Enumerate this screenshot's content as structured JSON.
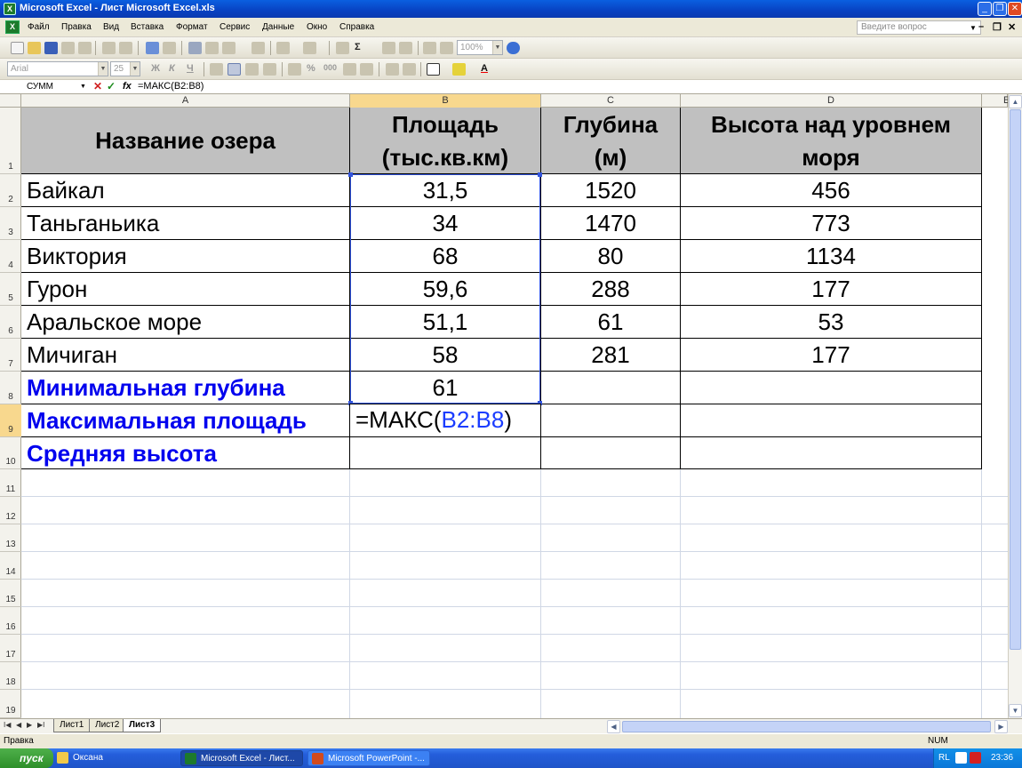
{
  "window": {
    "title": "Microsoft Excel - Лист Microsoft Excel.xls"
  },
  "menu": {
    "items": [
      "Файл",
      "Правка",
      "Вид",
      "Вставка",
      "Формат",
      "Сервис",
      "Данные",
      "Окно",
      "Справка"
    ],
    "help_placeholder": "Введите вопрос"
  },
  "toolbar": {
    "zoom": "100%",
    "font_name": "Arial",
    "font_size": "25",
    "sigma": "Σ",
    "bold": "Ж",
    "italic": "К",
    "underline": "Ч",
    "percent": "%",
    "thousands": "000",
    "font_color": "A"
  },
  "formula_bar": {
    "name_box": "СУММ",
    "fx": "fx",
    "formula": "=МАКС(B2:B8)"
  },
  "columns": [
    "A",
    "B",
    "C",
    "D",
    "E"
  ],
  "rows": [
    "1",
    "2",
    "3",
    "4",
    "5",
    "6",
    "7",
    "8",
    "9",
    "10",
    "11",
    "12",
    "13",
    "14",
    "15",
    "16",
    "17",
    "18",
    "19"
  ],
  "table": {
    "headers": [
      "Название озера",
      "Площадь (тыс.кв.км)",
      "Глубина (м)",
      "Высота над уровнем моря"
    ],
    "rows": [
      {
        "name": "Байкал",
        "area": "31,5",
        "depth": "1520",
        "height": "456"
      },
      {
        "name": "Таньганьика",
        "area": "34",
        "depth": "1470",
        "height": "773"
      },
      {
        "name": "Виктория",
        "area": "68",
        "depth": "80",
        "height": "1134"
      },
      {
        "name": "Гурон",
        "area": "59,6",
        "depth": "288",
        "height": "177"
      },
      {
        "name": "Аральское море",
        "area": "51,1",
        "depth": "61",
        "height": "53"
      },
      {
        "name": "Мичиган",
        "area": "58",
        "depth": "281",
        "height": "177"
      }
    ],
    "summary": [
      {
        "label": "Минимальная глубина",
        "value": "61"
      },
      {
        "label": "Максимальная площадь",
        "value": ""
      },
      {
        "label": "Средняя высота",
        "value": ""
      }
    ],
    "edit_prefix": "=МАКС(",
    "edit_ref": "B2:B8",
    "edit_suffix": ")"
  },
  "sheet_tabs": [
    "Лист1",
    "Лист2",
    "Лист3"
  ],
  "active_tab": "Лист3",
  "status": {
    "mode": "Правка",
    "num": "NUM"
  },
  "taskbar": {
    "start": "пуск",
    "tasks": [
      "Оксана",
      "Microsoft Excel - Лист...",
      "Microsoft PowerPoint -..."
    ],
    "lang": "RL",
    "clock": "23:36"
  }
}
